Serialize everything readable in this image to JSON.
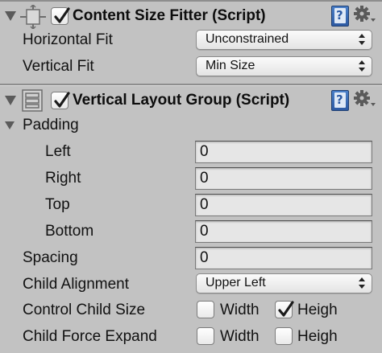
{
  "content_size_fitter": {
    "enabled": true,
    "title": "Content Size Fitter (Script)",
    "horizontal_fit": {
      "label": "Horizontal Fit",
      "value": "Unconstrained"
    },
    "vertical_fit": {
      "label": "Vertical Fit",
      "value": "Min Size"
    },
    "icon": "content-size-fitter-icon"
  },
  "vertical_layout_group": {
    "enabled": true,
    "title": "Vertical Layout Group (Script)",
    "icon": "vertical-layout-icon",
    "padding": {
      "label": "Padding",
      "left": {
        "label": "Left",
        "value": "0"
      },
      "right": {
        "label": "Right",
        "value": "0"
      },
      "top": {
        "label": "Top",
        "value": "0"
      },
      "bottom": {
        "label": "Bottom",
        "value": "0"
      }
    },
    "spacing": {
      "label": "Spacing",
      "value": "0"
    },
    "child_alignment": {
      "label": "Child Alignment",
      "value": "Upper Left"
    },
    "control_child_size": {
      "label": "Control Child Size",
      "width": {
        "label": "Width",
        "checked": false
      },
      "height": {
        "label": "Heigh",
        "checked": true
      }
    },
    "child_force_expand": {
      "label": "Child Force Expand",
      "width": {
        "label": "Width",
        "checked": false
      },
      "height": {
        "label": "Heigh",
        "checked": false
      }
    }
  },
  "colors": {
    "panel_bg": "#c2c2c2",
    "help_icon_blue": "#2d5aa3"
  }
}
